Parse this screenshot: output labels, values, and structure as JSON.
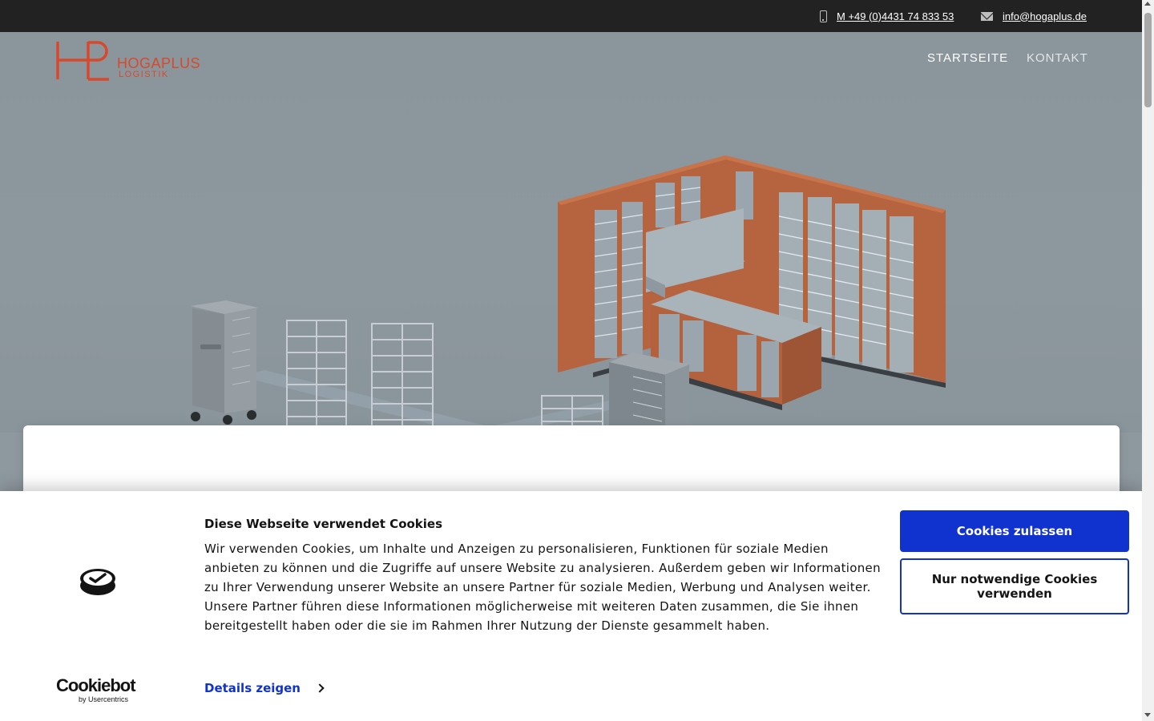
{
  "topbar": {
    "phone": {
      "text": "M +49 (0)4431 74 833 53",
      "icon": "phone-icon"
    },
    "email": {
      "text": "info@hogaplus.de",
      "icon": "mail-icon"
    }
  },
  "logo": {
    "word": "HOGAPLUS",
    "sub": "LOGISTIK",
    "color": "#d9482b"
  },
  "nav": [
    {
      "label": "STARTSEITE",
      "active": true
    },
    {
      "label": "KONTAKT",
      "active": false
    }
  ],
  "cookie_banner": {
    "title": "Diese Webseite verwendet Cookies",
    "body": "Wir verwenden Cookies, um Inhalte und Anzeigen zu personalisieren, Funktionen für soziale Medien anbieten zu können und die Zugriffe auf unsere Website zu analysieren. Außerdem geben wir Informationen zu Ihrer Verwendung unserer Website an unsere Partner für soziale Medien, Werbung und Analysen weiter. Unsere Partner führen diese Informationen möglicherweise mit weiteren Daten zusammen, die Sie ihnen bereitgestellt haben oder die sie im Rahmen Ihrer Nutzung der Dienste gesammelt haben.",
    "details_link": "Details zeigen",
    "allow_button": "Cookies zulassen",
    "necessary_button": "Nur notwendige Cookies verwenden",
    "brand": {
      "name": "Cookiebot",
      "byline": "by Usercentrics"
    },
    "accent_color": "#1032cf"
  }
}
